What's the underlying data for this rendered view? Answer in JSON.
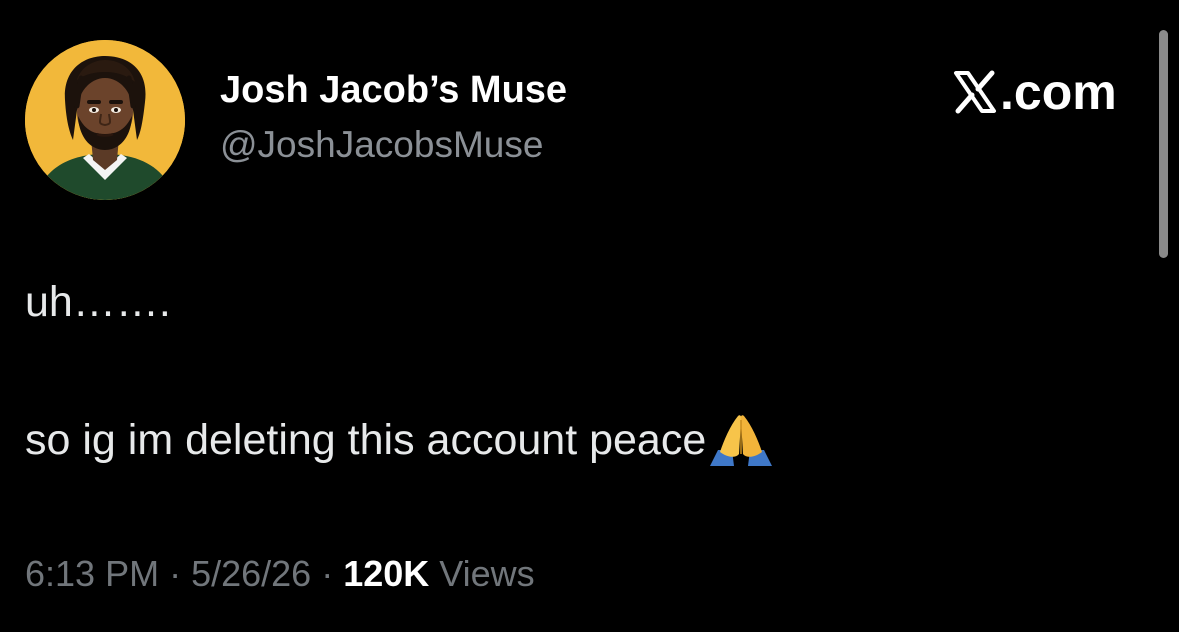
{
  "author": {
    "display_name": "Josh Jacob’s Muse",
    "handle": "@JoshJacobsMuse",
    "avatar_icon": "cartoon-portrait-avatar"
  },
  "brand": {
    "logo_icon": "x-logo-icon",
    "text": ".com"
  },
  "tweet": {
    "line_1": "uh…….",
    "line_2": "so ig im deleting this account peace",
    "emoji_icon": "folded-hands-emoji"
  },
  "meta": {
    "time": "6:13 PM",
    "separator_1": " · ",
    "date": "5/26/26",
    "separator_2": " · ",
    "views_count": "120K",
    "views_label": " Views"
  },
  "colors": {
    "background": "#000000",
    "primary_text": "#e7e9ea",
    "secondary_text": "#71767b",
    "avatar_background": "#f2b83a"
  }
}
